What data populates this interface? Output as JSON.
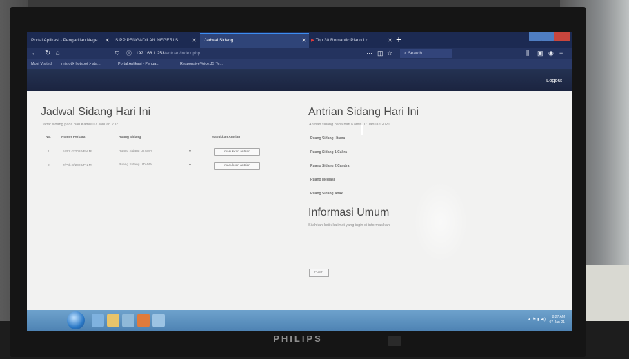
{
  "browser": {
    "tabs": [
      {
        "label": "Portal Aplikasi - Pengadilan Nege"
      },
      {
        "label": "SIPP PENGADILAN NEGERI S"
      },
      {
        "label": "Jadwal Sidang"
      },
      {
        "label": "Top 30 Romantic Piano Lo"
      }
    ],
    "url_host": "192.168.1.253",
    "url_path": "/antrian/index.php",
    "search_placeholder": "Search",
    "bookmarks": [
      "Most Visited",
      "mikrotik hotspot > sta...",
      "Portal Aplikasi - Penga...",
      "ResponsiveVoice.JS Te..."
    ]
  },
  "header": {
    "logout_label": "Logout"
  },
  "jadwal": {
    "title": "Jadwal Sidang Hari Ini",
    "subtitle": "Daftar sidang pada hari Kamis,07 Januari 2021",
    "columns": [
      "No.",
      "Nomor Perkara",
      "Ruang Sidang",
      "Masukkan Antrian"
    ],
    "rows": [
      {
        "no": "1",
        "perkara": "5/Pdt.G/2020/PN.Mt",
        "ruang": "Ruang Sidang UTAMA",
        "action": "masukkan antrian"
      },
      {
        "no": "2",
        "perkara": "7/Pdt.G/2020/PN.Mt",
        "ruang": "Ruang Sidang UTAMA",
        "action": "masukkan antrian"
      }
    ]
  },
  "antrian": {
    "title": "Antrian Sidang Hari Ini",
    "subtitle": "Antrian sidang pada hari Kamis,07 Januari 2021",
    "rooms": [
      "Ruang Sidang Utama",
      "Ruang Sidang 1 Cakra",
      "Ruang Sidang 2 Candra",
      "Ruang Mediasi",
      "Ruang Sidang Anak"
    ]
  },
  "info": {
    "title": "Informasi Umum",
    "placeholder": "Silahkan ketik kalimat yang ingin di informasikan",
    "push_label": "PUSH"
  },
  "taskbar": {
    "time": "8:27 AM",
    "date": "07-Jan-21"
  },
  "monitor": {
    "brand": "PHILIPS"
  },
  "colors": {
    "tabbar": "#1c2a52",
    "taskbar": "#5a8fbf",
    "page_bg": "#f2f2f1"
  }
}
